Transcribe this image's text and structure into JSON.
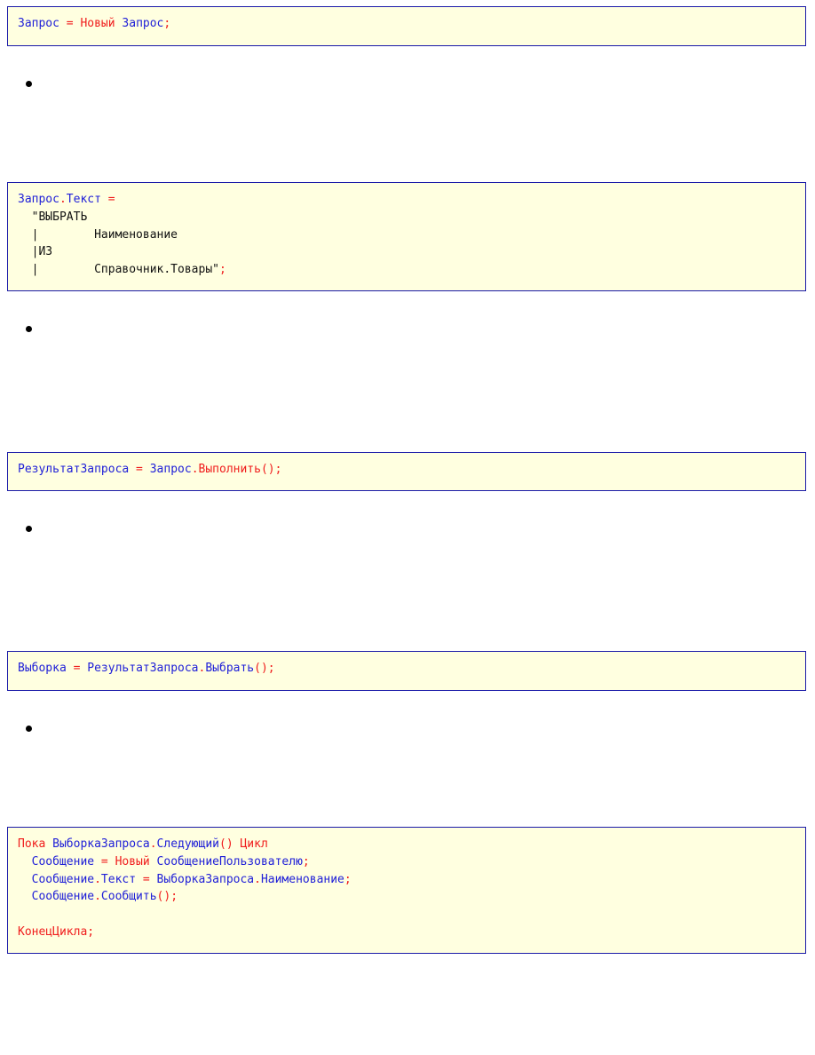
{
  "blocks": [
    {
      "lines": [
        [
          {
            "t": "Запрос",
            "c": "i"
          },
          {
            "t": " = ",
            "c": "k"
          },
          {
            "t": "Новый",
            "c": "k"
          },
          {
            "t": " Запрос",
            "c": "i"
          },
          {
            "t": ";",
            "c": "k"
          }
        ]
      ]
    },
    {
      "lines": [
        [
          {
            "t": "Запрос",
            "c": "i"
          },
          {
            "t": ".",
            "c": "k"
          },
          {
            "t": "Текст",
            "c": "i"
          },
          {
            "t": " =",
            "c": "k"
          }
        ],
        [
          {
            "t": "  \"ВЫБРАТЬ",
            "c": "s"
          }
        ],
        [
          {
            "t": "  |        Наименование",
            "c": "s"
          }
        ],
        [
          {
            "t": "  |ИЗ",
            "c": "s"
          }
        ],
        [
          {
            "t": "  |        Справочник.Товары\"",
            "c": "s"
          },
          {
            "t": ";",
            "c": "k"
          }
        ]
      ]
    },
    {
      "lines": [
        [
          {
            "t": "РезультатЗапроса",
            "c": "i"
          },
          {
            "t": " = ",
            "c": "k"
          },
          {
            "t": "Запрос",
            "c": "i"
          },
          {
            "t": ".",
            "c": "k"
          },
          {
            "t": "Выполнить",
            "c": "k"
          },
          {
            "t": "();",
            "c": "k"
          }
        ]
      ]
    },
    {
      "lines": [
        [
          {
            "t": "Выборка",
            "c": "i"
          },
          {
            "t": " = ",
            "c": "k"
          },
          {
            "t": "РезультатЗапроса",
            "c": "i"
          },
          {
            "t": ".",
            "c": "k"
          },
          {
            "t": "Выбрать",
            "c": "i"
          },
          {
            "t": "();",
            "c": "k"
          }
        ]
      ]
    },
    {
      "lines": [
        [
          {
            "t": "Пока",
            "c": "k"
          },
          {
            "t": " ВыборкаЗапроса",
            "c": "i"
          },
          {
            "t": ".",
            "c": "k"
          },
          {
            "t": "Следующий",
            "c": "i"
          },
          {
            "t": "()",
            "c": "k"
          },
          {
            "t": " Цикл",
            "c": "k"
          }
        ],
        [
          {
            "t": "  Сообщение",
            "c": "i"
          },
          {
            "t": " = ",
            "c": "k"
          },
          {
            "t": "Новый",
            "c": "k"
          },
          {
            "t": " СообщениеПользователю",
            "c": "i"
          },
          {
            "t": ";",
            "c": "k"
          }
        ],
        [
          {
            "t": "  Сообщение",
            "c": "i"
          },
          {
            "t": ".",
            "c": "k"
          },
          {
            "t": "Текст",
            "c": "i"
          },
          {
            "t": " = ",
            "c": "k"
          },
          {
            "t": "ВыборкаЗапроса",
            "c": "i"
          },
          {
            "t": ".",
            "c": "k"
          },
          {
            "t": "Наименование",
            "c": "i"
          },
          {
            "t": ";",
            "c": "k"
          }
        ],
        [
          {
            "t": "  Сообщение",
            "c": "i"
          },
          {
            "t": ".",
            "c": "k"
          },
          {
            "t": "Сообщить",
            "c": "i"
          },
          {
            "t": "();",
            "c": "k"
          }
        ],
        [],
        [
          {
            "t": "КонецЦикла",
            "c": "k"
          },
          {
            "t": ";",
            "c": "k"
          }
        ]
      ]
    }
  ],
  "colors": {
    "keyword": "#f01c1c",
    "identifier": "#2020d8",
    "string": "#111111",
    "code_background": "#ffffe0",
    "code_border": "#1a1aa8",
    "bullet": "#000000"
  }
}
